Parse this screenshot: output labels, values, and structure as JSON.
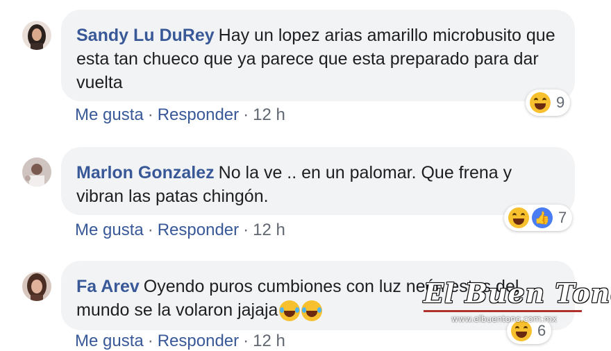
{
  "comments": [
    {
      "author": "Sandy Lu DuRey",
      "text": "Hay un lopez arias amarillo microbusito que esta tan chueco que ya parece que esta preparado para dar vuelta",
      "like_label": "Me gusta",
      "reply_label": "Responder",
      "time": "12 h",
      "reaction_count": "9",
      "reaction_icons": [
        "laugh-icon"
      ]
    },
    {
      "author": "Marlon Gonzalez",
      "text": "No la ve .. en un palomar. Que frena y vibran las patas chingón.",
      "like_label": "Me gusta",
      "reply_label": "Responder",
      "time": "12 h",
      "reaction_count": "7",
      "reaction_icons": [
        "laugh-icon",
        "like-icon"
      ]
    },
    {
      "author": "Fa Arev",
      "text": "Oyendo puros cumbiones con luz neón estos del mundo se la volaron jajaja",
      "like_label": "Me gusta",
      "reply_label": "Responder",
      "time": "12 h",
      "reaction_count": "6",
      "reaction_icons": [
        "laugh-icon"
      ]
    }
  ],
  "separator": "·",
  "watermark": {
    "title": "El Buen Tono",
    "url": "www.elbuentono.com.mx"
  },
  "colors": {
    "author": "#385898",
    "bubble": "#f2f3f5",
    "accent_line": "#b0302a"
  }
}
